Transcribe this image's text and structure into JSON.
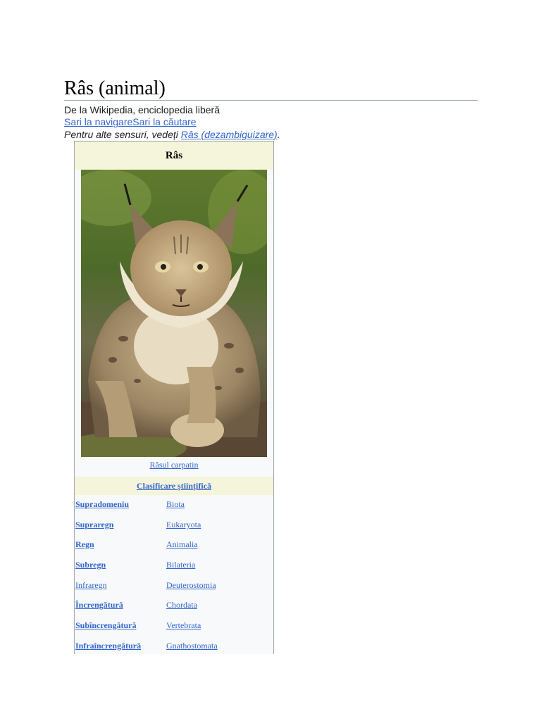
{
  "article": {
    "title": "Râs (animal)",
    "subtitle": "De la Wikipedia, enciclopedia liberă",
    "jump_navigation": "Sari la navigare",
    "jump_search": "Sari la căutare",
    "hatnote_prefix": "Pentru alte sensuri, vedeți ",
    "hatnote_link": "Râs (dezambiguizare)",
    "hatnote_suffix": "."
  },
  "infobox": {
    "title": "Râs",
    "image_caption": "Râsul carpatin",
    "classification_header": "Clasificare științifică",
    "taxonomy": [
      {
        "rank": "Supradomeniu",
        "value": "Biota",
        "bold": false
      },
      {
        "rank": "Supraregn",
        "value": "Eukaryota",
        "bold": false
      },
      {
        "rank": "Regn",
        "value": "Animalia",
        "bold": true
      },
      {
        "rank": "Subregn",
        "value": "Bilateria",
        "bold": true
      },
      {
        "rank": "Infraregn",
        "value": "Deuterostomia",
        "bold": false
      },
      {
        "rank": "Încrengătură",
        "value": "Chordata",
        "bold": true
      },
      {
        "rank": "Subîncrengătură",
        "value": "Vertebrata",
        "bold": true
      },
      {
        "rank": "Infraîncrengătură",
        "value": "Gnathostomata",
        "bold": false
      }
    ]
  },
  "colors": {
    "link": "#3366cc",
    "infobox_header": "#f5f5dc",
    "infobox_bg": "#f8f9fa",
    "border": "#a2a9b1"
  }
}
